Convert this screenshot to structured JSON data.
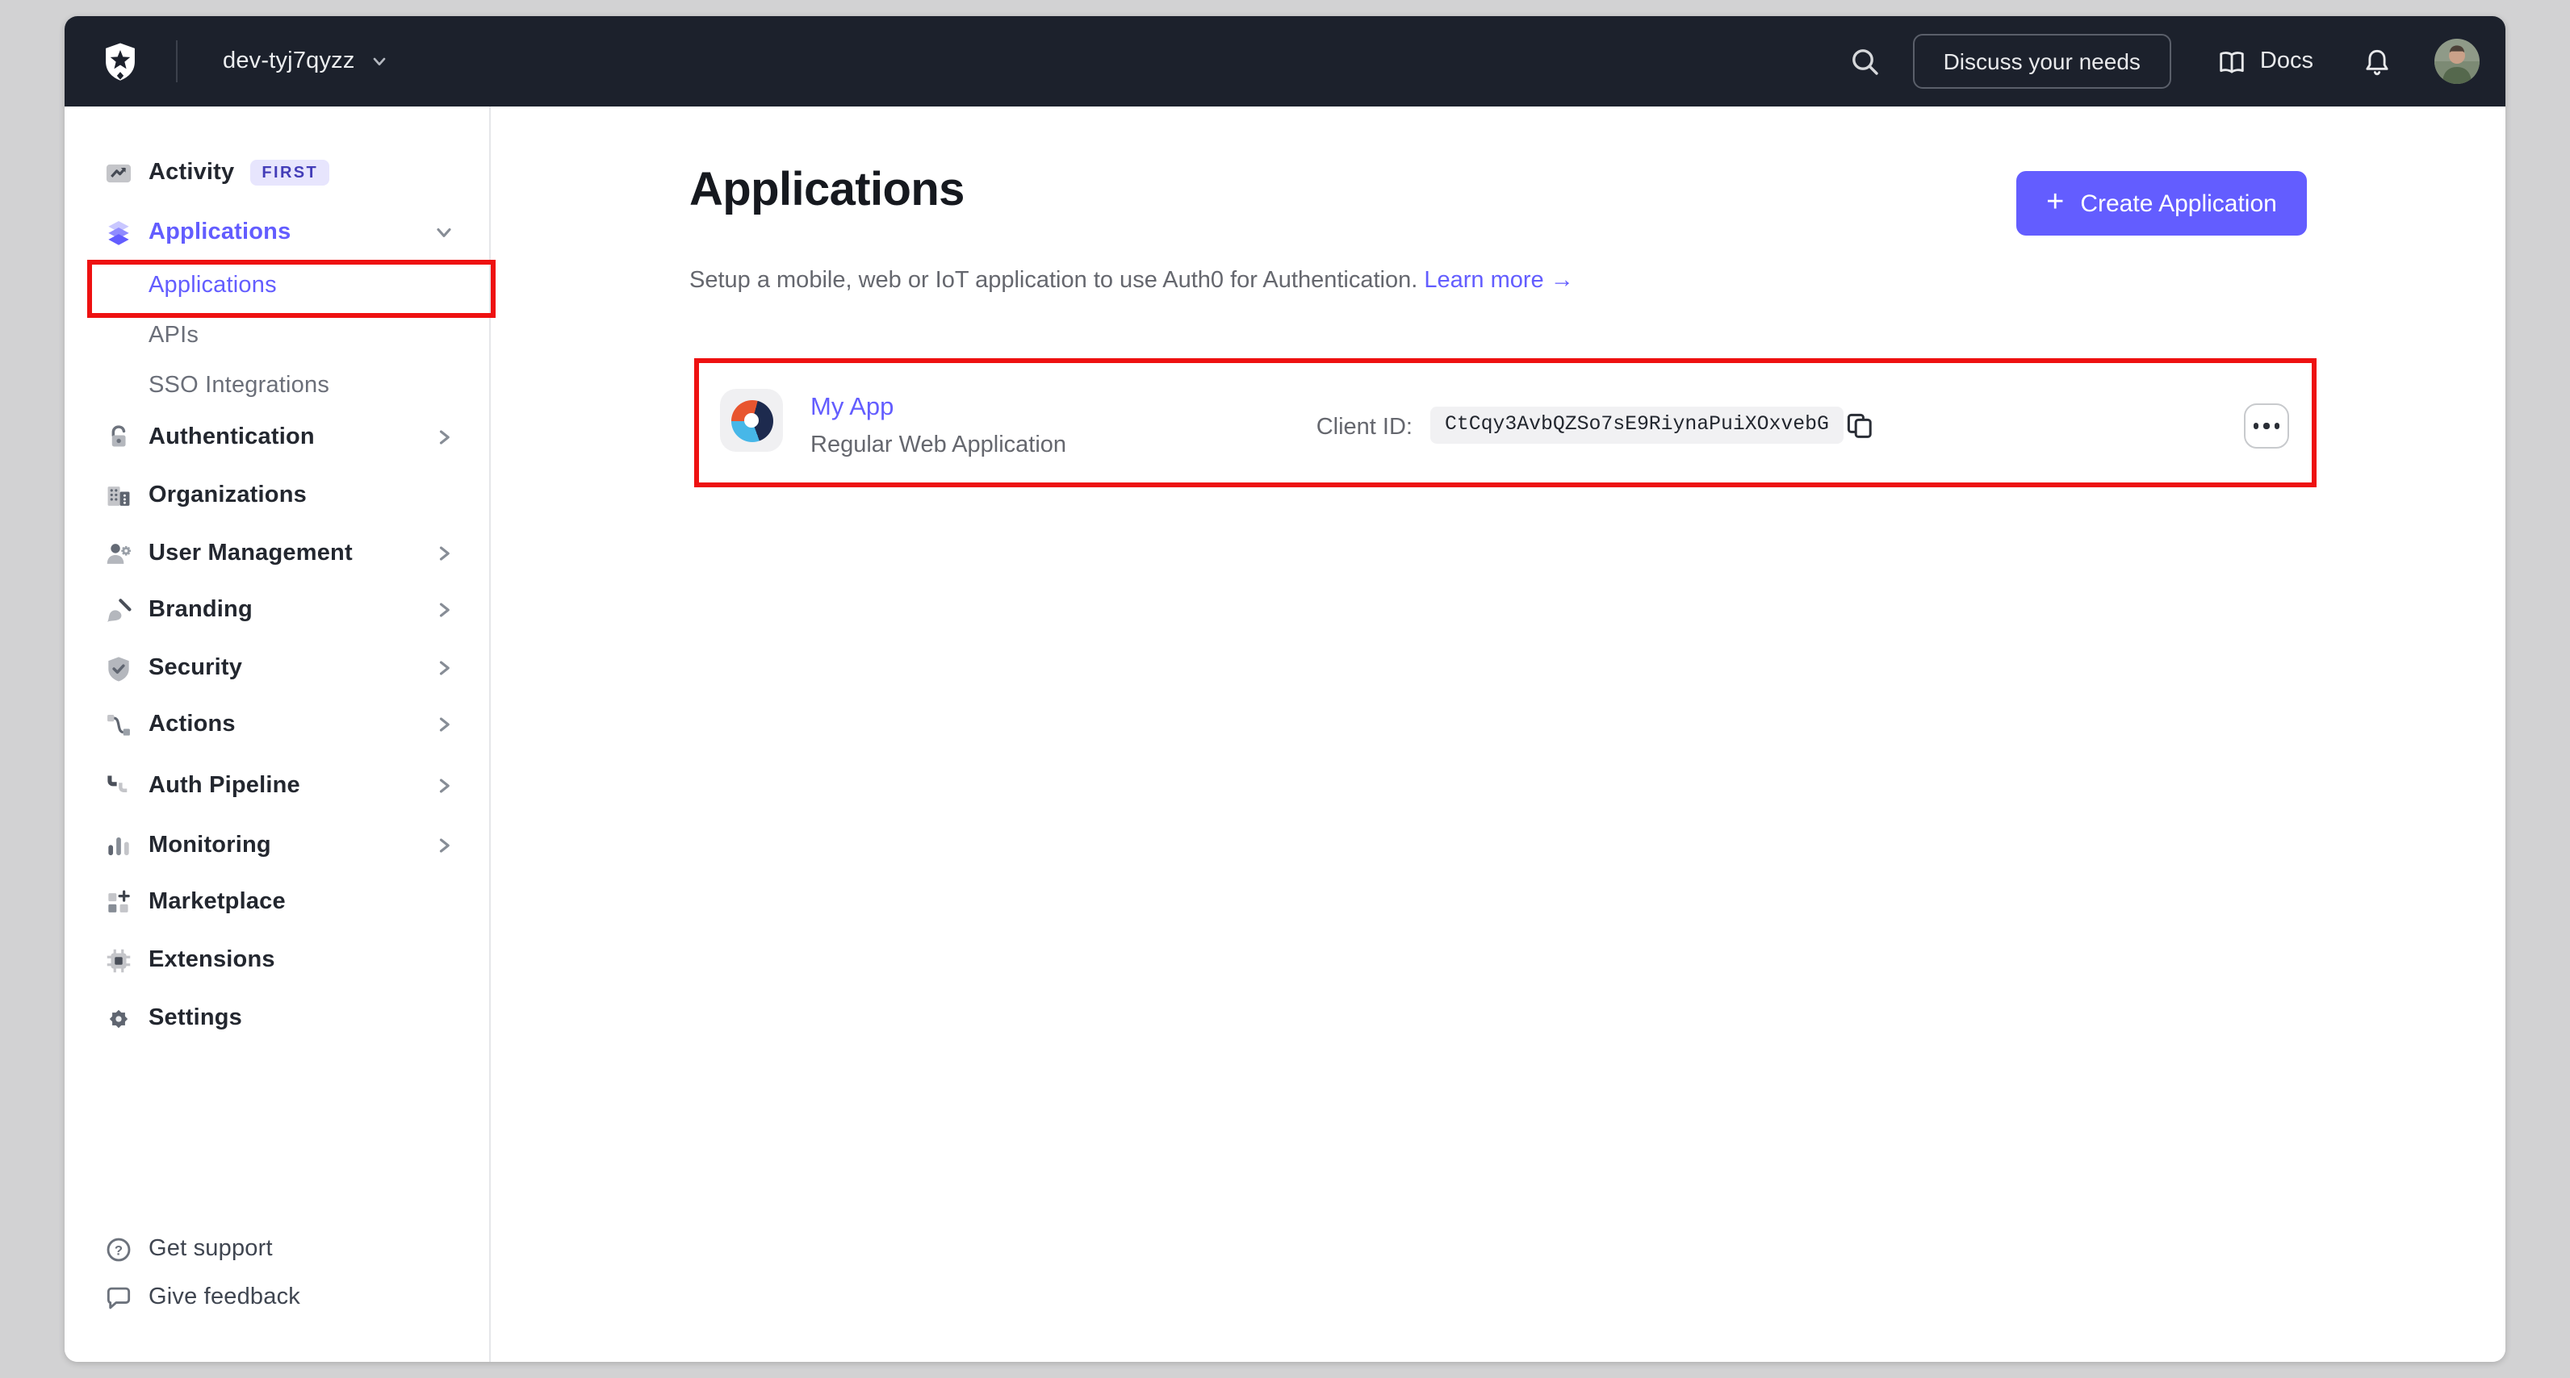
{
  "colors": {
    "accent": "#635dff",
    "annotation": "#ee1111",
    "topbar_bg": "#1c212c",
    "frame_bg": "#d2d2d3"
  },
  "topbar": {
    "tenant": "dev-tyj7qyzz",
    "discuss_button": "Discuss your needs",
    "docs_label": "Docs"
  },
  "sidebar": {
    "items": [
      {
        "label": "Activity",
        "badge": "FIRST"
      },
      {
        "label": "Applications",
        "children": [
          {
            "label": "Applications",
            "selected": true
          },
          {
            "label": "APIs"
          },
          {
            "label": "SSO Integrations"
          }
        ]
      },
      {
        "label": "Authentication"
      },
      {
        "label": "Organizations"
      },
      {
        "label": "User Management"
      },
      {
        "label": "Branding"
      },
      {
        "label": "Security"
      },
      {
        "label": "Actions"
      },
      {
        "label": "Auth Pipeline"
      },
      {
        "label": "Monitoring"
      },
      {
        "label": "Marketplace"
      },
      {
        "label": "Extensions"
      },
      {
        "label": "Settings"
      }
    ],
    "footer": [
      {
        "label": "Get support"
      },
      {
        "label": "Give feedback"
      }
    ]
  },
  "main": {
    "title": "Applications",
    "subtitle": "Setup a mobile, web or IoT application to use Auth0 for Authentication.",
    "learn_more": "Learn more →",
    "create_button": "Create Application",
    "application": {
      "name": "My App",
      "type": "Regular Web Application",
      "client_id_label": "Client ID:",
      "client_id": "CtCqy3AvbQZSo7sE9RiynaPuiXOxvebG"
    }
  }
}
